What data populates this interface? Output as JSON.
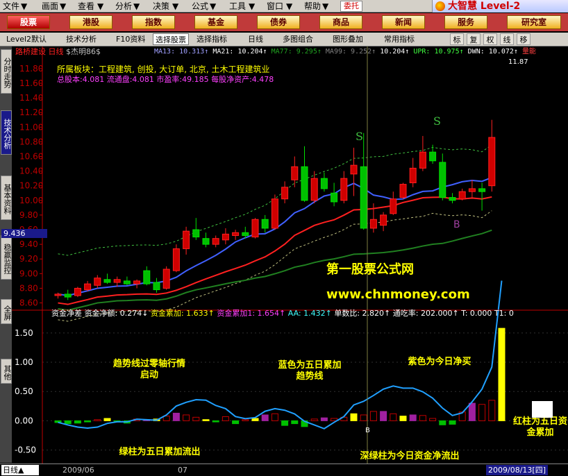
{
  "menu": [
    "文件",
    "画面",
    "查看",
    "分析",
    "决策",
    "公式",
    "工具",
    "窗口",
    "帮助"
  ],
  "menu_mark": "▼",
  "weituo": "委托",
  "brand": "大智慧 Level-2",
  "quicknav": [
    "股票",
    "港股",
    "指数",
    "基金",
    "债券",
    "商品",
    "新闻",
    "服务",
    "研究室"
  ],
  "toolbar": {
    "items": [
      "Level2默认",
      "技术分析",
      "F10资料",
      "选择股票",
      "选择指标",
      "日线",
      "多图组合",
      "图形叠加",
      "常用指标"
    ],
    "icons": [
      "标",
      "复",
      "权",
      "线",
      "移"
    ]
  },
  "sidebar": [
    "分时走势",
    "技术分析",
    "基本资料",
    "稳赢监控",
    "全屏",
    "其他"
  ],
  "stock": {
    "name": "路桥建设",
    "period": "日线",
    "author": "$杰明86$"
  },
  "ma": [
    {
      "label": "MA13: 10.313↑",
      "color": "#a0a0ff"
    },
    {
      "label": "MA21: 10.204↑",
      "color": "#ffffff"
    },
    {
      "label": "MA77: 9.295↑",
      "color": "#20a020"
    },
    {
      "label": "MA99: 9.252↑",
      "color": "#808080"
    },
    {
      "label": "10.204↑",
      "color": "#ffffff"
    },
    {
      "label": "UPR: 10.975↑",
      "color": "#40ff40"
    },
    {
      "label": "DWN: 10.072↑",
      "color": "#ffffff"
    },
    {
      "label": "量能",
      "color": "#ff4040"
    }
  ],
  "info": {
    "sector": "所属板块：工程建筑, 创投, 大订单, 北京, 土木工程建筑业",
    "capital": "总股本:4.081  流通盘:4.081  市盈率:49.185 每股净资产:4.478"
  },
  "current_price": "9.436",
  "high_mark": "11.87",
  "price_axis": [
    "11.80",
    "11.60",
    "11.40",
    "11.20",
    "11.00",
    "10.80",
    "10.60",
    "10.40",
    "10.20",
    "10.00",
    "9.80",
    "9.60",
    "9.40",
    "9.20",
    "9.00",
    "8.80",
    "8.60"
  ],
  "indicator": {
    "header": [
      {
        "label": "资金净差",
        "color": "#ffffff"
      },
      {
        "label": "资金净额: 0.274↓",
        "color": "#ffffff"
      },
      {
        "label": "资金累加: 1.633↑",
        "color": "#ffff00"
      },
      {
        "label": "资金累加1: 1.654↑",
        "color": "#ff40ff"
      },
      {
        "label": "AA: 1.432↑",
        "color": "#40ffff"
      },
      {
        "label": "单数比: 2.820↑",
        "color": "#ffffff"
      },
      {
        "label": "通吃率: 202.000↑",
        "color": "#ffffff"
      },
      {
        "label": "T: 0.000",
        "color": "#ffffff"
      },
      {
        "label": "T1: 0",
        "color": "#ffffff"
      }
    ],
    "axis": [
      "1.50",
      "1.00",
      "0.50",
      "0.00",
      "-0.50"
    ]
  },
  "markers": {
    "S": "S",
    "B": "B"
  },
  "watermark": {
    "line1": "第一股票公式网",
    "line2": "www.chnmoney.com"
  },
  "annotations": {
    "a1": "趋势线过零轴行情启动",
    "a2": "蓝色为五日累加趋势线",
    "a3": "紫色为今日净买",
    "a4": "绿柱为五日累加流出",
    "a5": "深绿柱为今日资金净流出",
    "a6": "红柱为五日资金累加"
  },
  "status": {
    "period": "日线▲",
    "date1": "2009/06",
    "date2": "07",
    "current": "2009/08/13[四]"
  },
  "chart_data": {
    "type": "candlestick",
    "price_range": [
      8.52,
      11.95
    ],
    "candles": [
      [
        8.7,
        8.74,
        8.66,
        8.72
      ],
      [
        8.72,
        8.78,
        8.64,
        8.68
      ],
      [
        8.7,
        8.82,
        8.68,
        8.8
      ],
      [
        8.78,
        8.9,
        8.76,
        8.86
      ],
      [
        8.84,
        8.98,
        8.8,
        8.94
      ],
      [
        8.92,
        9.0,
        8.86,
        8.88
      ],
      [
        8.88,
        8.96,
        8.82,
        8.92
      ],
      [
        8.9,
        8.96,
        8.84,
        8.86
      ],
      [
        8.86,
        8.92,
        8.8,
        8.9
      ],
      [
        9.04,
        9.1,
        8.84,
        8.86
      ],
      [
        8.88,
        8.94,
        8.74,
        8.78
      ],
      [
        8.8,
        9.1,
        8.78,
        9.06
      ],
      [
        9.04,
        9.4,
        9.02,
        9.34
      ],
      [
        9.34,
        9.64,
        9.26,
        9.58
      ],
      [
        9.6,
        9.76,
        9.46,
        9.5
      ],
      [
        9.48,
        9.56,
        9.36,
        9.4
      ],
      [
        9.4,
        9.52,
        9.36,
        9.48
      ],
      [
        9.46,
        9.62,
        9.4,
        9.54
      ],
      [
        9.52,
        9.6,
        9.46,
        9.56
      ],
      [
        9.56,
        9.64,
        9.48,
        9.52
      ],
      [
        9.5,
        9.76,
        9.48,
        9.74
      ],
      [
        9.74,
        9.8,
        9.56,
        9.62
      ],
      [
        9.62,
        10.08,
        9.6,
        10.02
      ],
      [
        10.02,
        10.26,
        9.96,
        10.18
      ],
      [
        10.28,
        10.6,
        10.18,
        10.46
      ],
      [
        10.46,
        10.74,
        9.98,
        10.0
      ],
      [
        10.0,
        10.4,
        9.96,
        10.3
      ],
      [
        10.3,
        10.38,
        10.12,
        10.16
      ],
      [
        10.1,
        10.24,
        9.92,
        9.98
      ],
      [
        10.0,
        10.4,
        9.96,
        10.3
      ],
      [
        10.36,
        10.72,
        10.06,
        10.48
      ],
      [
        10.46,
        10.92,
        9.6,
        9.62
      ],
      [
        9.62,
        9.96,
        9.56,
        9.74
      ],
      [
        9.66,
        9.84,
        9.58,
        9.8
      ],
      [
        9.82,
        10.12,
        9.8,
        10.02
      ],
      [
        10.04,
        10.24,
        10.02,
        10.22
      ],
      [
        10.24,
        10.58,
        10.18,
        10.44
      ],
      [
        10.44,
        10.88,
        10.4,
        10.66
      ],
      [
        10.66,
        10.76,
        10.5,
        10.54
      ],
      [
        10.52,
        10.64,
        10.0,
        10.04
      ],
      [
        10.04,
        10.1,
        9.96,
        10.0
      ],
      [
        10.02,
        10.16,
        10.0,
        10.12
      ],
      [
        10.12,
        10.28,
        10.02,
        10.16
      ],
      [
        10.16,
        10.24,
        9.86,
        10.12
      ],
      [
        10.2,
        11.1,
        10.12,
        10.86
      ]
    ],
    "indicator_bars": [
      -0.03,
      -0.05,
      -0.04,
      -0.02,
      0.02,
      0.04,
      -0.02,
      -0.04,
      0.03,
      0.01,
      0.03,
      0.08,
      0.13,
      0.1,
      0.06,
      0.02,
      -0.02,
      0.07,
      -0.05,
      0.02,
      0.04,
      0.1,
      0.12,
      -0.08,
      -0.05,
      -0.1,
      0.03,
      0.05,
      0.04,
      0.06,
      0.12,
      0.1,
      0.16,
      0.16,
      0.12,
      0.08,
      0.1,
      0.09,
      0.04,
      -0.07,
      -0.06,
      0.15,
      0.3,
      0.28,
      0.35,
      1.58
    ]
  }
}
